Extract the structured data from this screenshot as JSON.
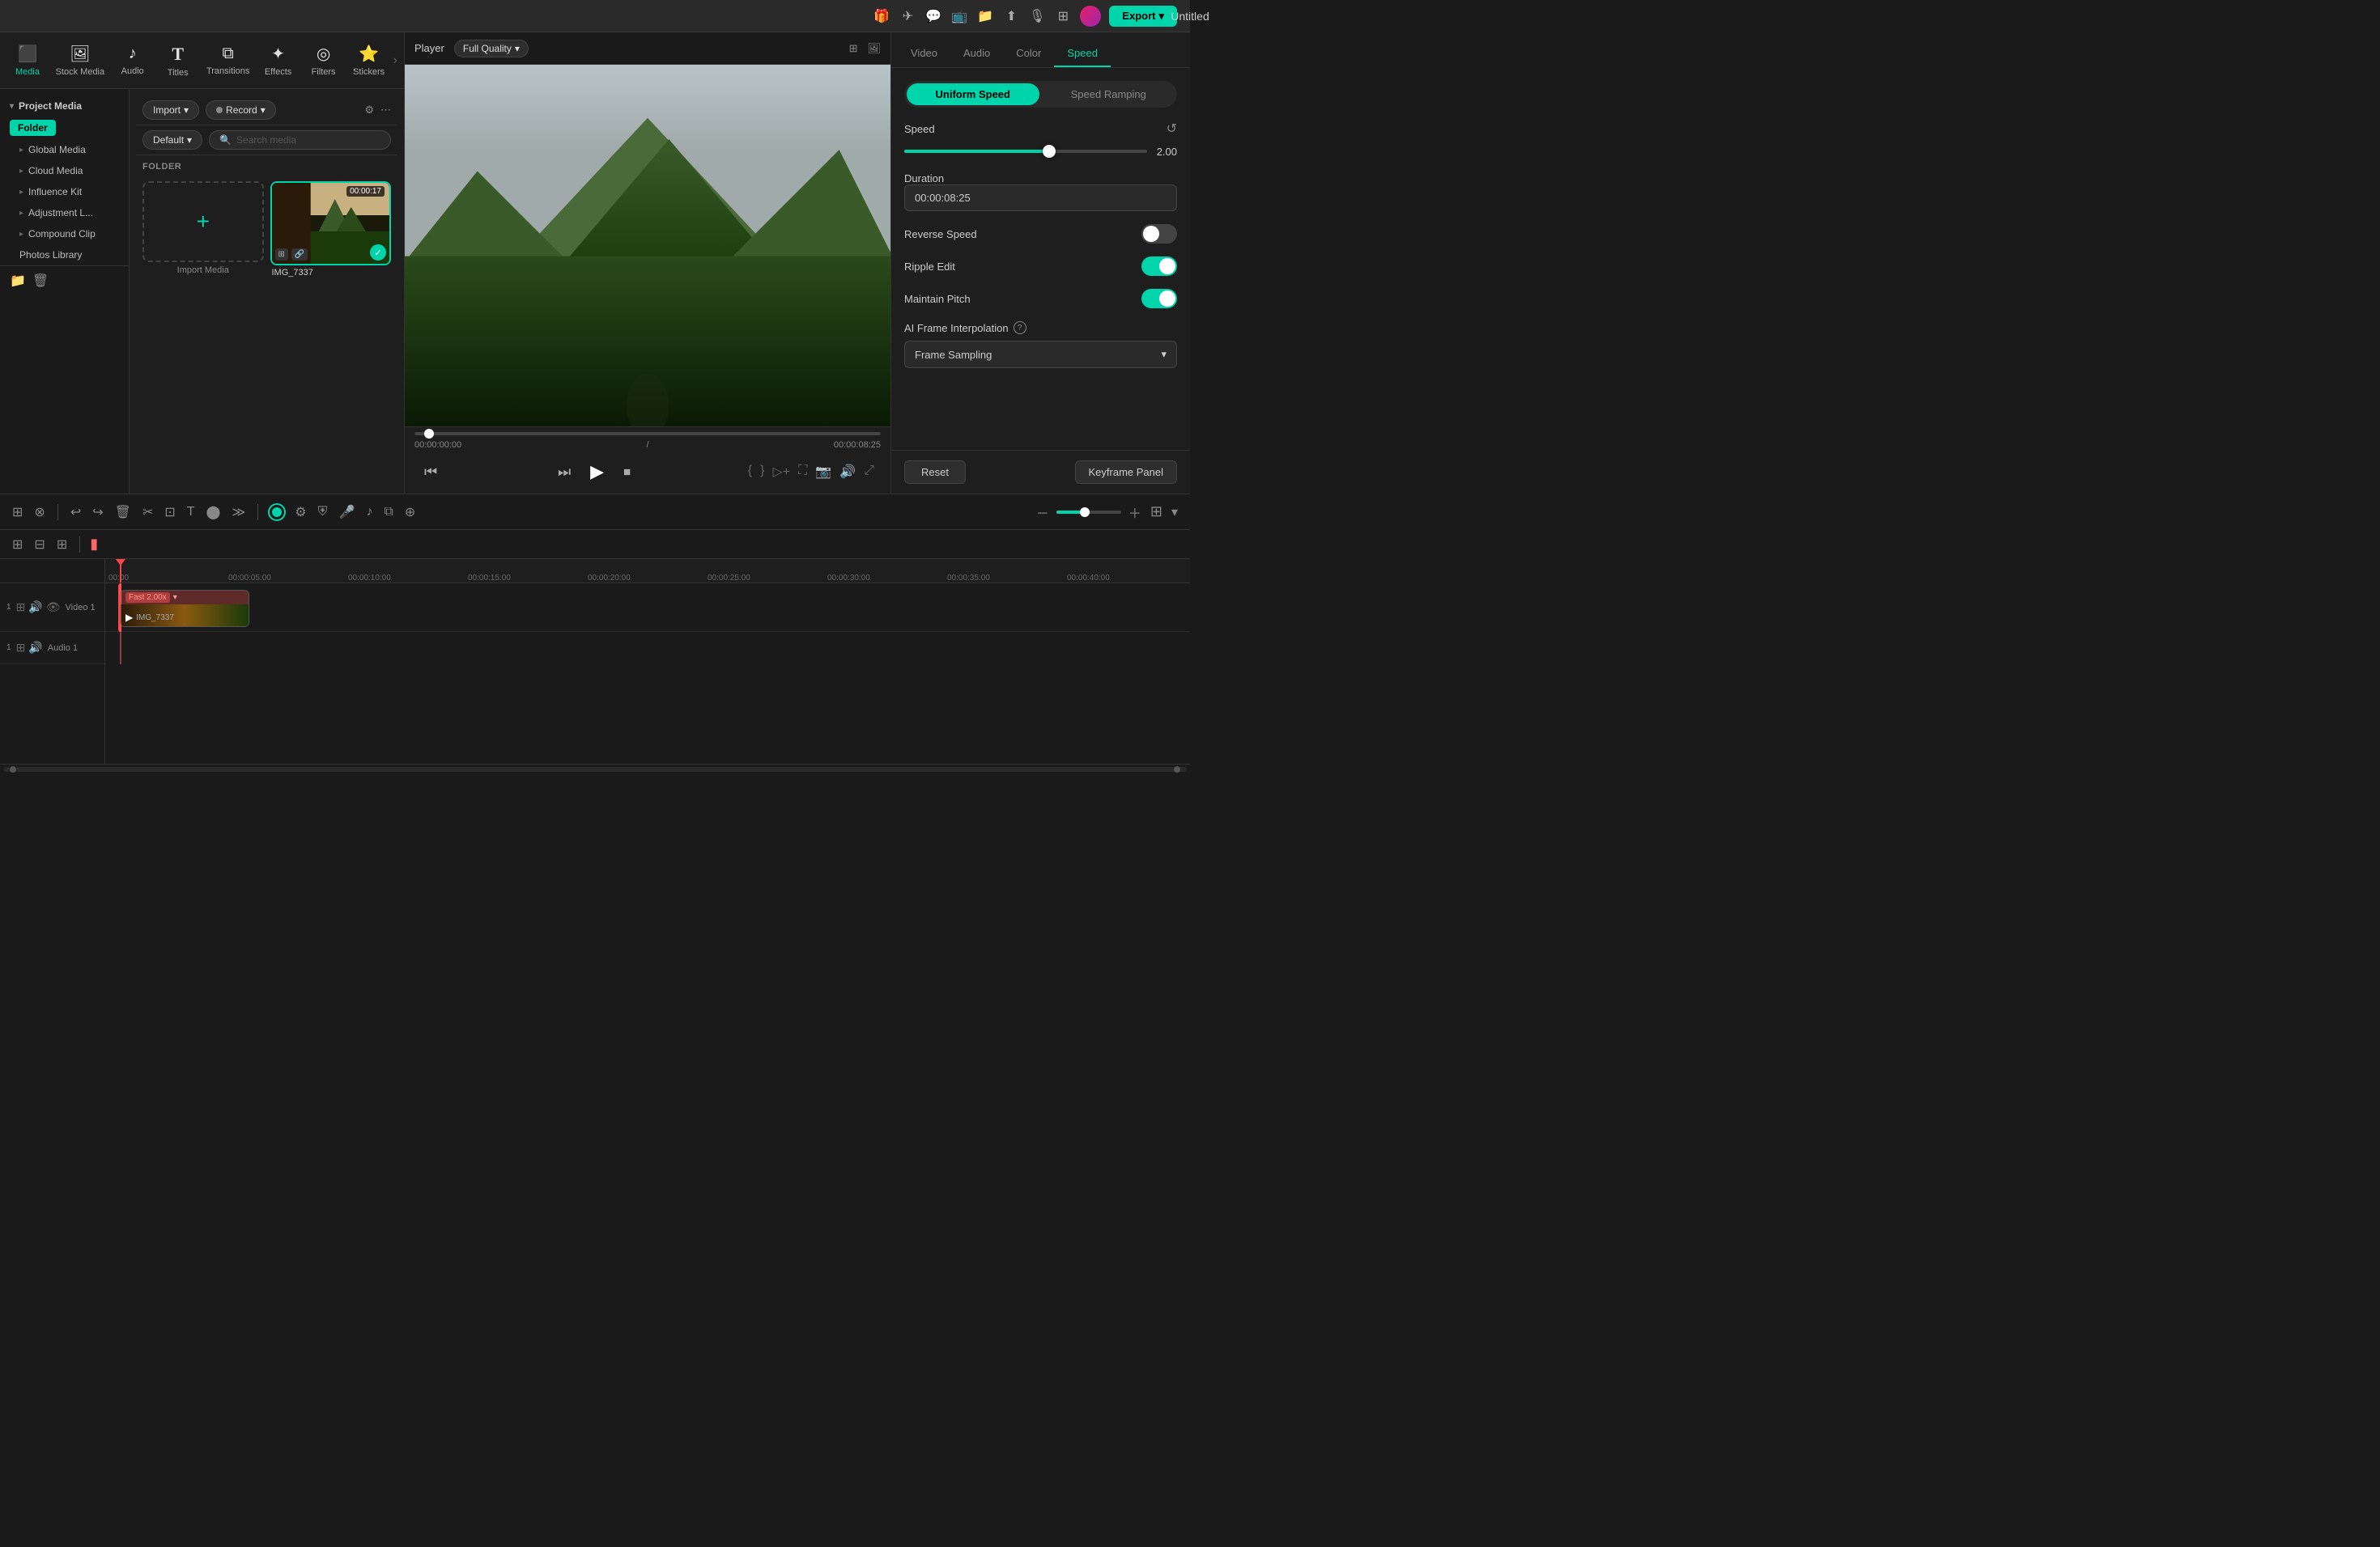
{
  "app": {
    "title": "Untitled"
  },
  "topbar": {
    "export_label": "Export"
  },
  "media_toolbar": {
    "items": [
      {
        "id": "media",
        "label": "Media",
        "icon": "🎬",
        "active": true
      },
      {
        "id": "stock",
        "label": "Stock Media",
        "icon": "🏛"
      },
      {
        "id": "audio",
        "label": "Audio",
        "icon": "🎵"
      },
      {
        "id": "titles",
        "label": "Titles",
        "icon": "T"
      },
      {
        "id": "transitions",
        "label": "Transitions",
        "icon": "⧉"
      },
      {
        "id": "effects",
        "label": "Effects",
        "icon": "✦"
      },
      {
        "id": "filters",
        "label": "Filters",
        "icon": "🔘"
      },
      {
        "id": "stickers",
        "label": "Stickers",
        "icon": "⭐"
      }
    ]
  },
  "sidebar": {
    "project_media": "Project Media",
    "folder": "Folder",
    "global_media": "Global Media",
    "cloud_media": "Cloud Media",
    "influence_kit": "Influence Kit",
    "adjustment_l": "Adjustment L...",
    "compound_clip": "Compound Clip",
    "photos_library": "Photos Library"
  },
  "media_panel": {
    "import_label": "Import",
    "record_label": "Record",
    "default_label": "Default",
    "search_placeholder": "Search media",
    "folder_label": "FOLDER",
    "import_media_label": "Import Media",
    "media_item": {
      "name": "IMG_7337",
      "duration": "00:00:17"
    }
  },
  "player": {
    "label": "Player",
    "quality": "Full Quality",
    "current_time": "00:00:00:00",
    "total_time": "00:00:08:25"
  },
  "right_panel": {
    "tabs": [
      "Video",
      "Audio",
      "Color",
      "Speed"
    ],
    "active_tab": "Speed",
    "speed_tabs": [
      "Uniform Speed",
      "Speed Ramping"
    ],
    "active_speed_tab": "Uniform Speed",
    "speed_label": "Speed",
    "speed_value": "2.00",
    "duration_label": "Duration",
    "duration_value": "00:00:08:25",
    "reverse_speed_label": "Reverse Speed",
    "ripple_edit_label": "Ripple Edit",
    "maintain_pitch_label": "Maintain Pitch",
    "ai_frame_label": "AI Frame Interpolation",
    "frame_sampling_label": "Frame Sampling",
    "reset_label": "Reset",
    "keyframe_label": "Keyframe Panel"
  },
  "timeline": {
    "video_track": "Video 1",
    "audio_track": "Audio 1",
    "clip_name": "IMG_7337",
    "clip_speed": "Fast 2.00x",
    "ruler_marks": [
      "00:00",
      "00:00:05:00",
      "00:00:10:00",
      "00:00:15:00",
      "00:00:20:00",
      "00:00:25:00",
      "00:00:30:00",
      "00:00:35:00",
      "00:00:40:00"
    ]
  }
}
